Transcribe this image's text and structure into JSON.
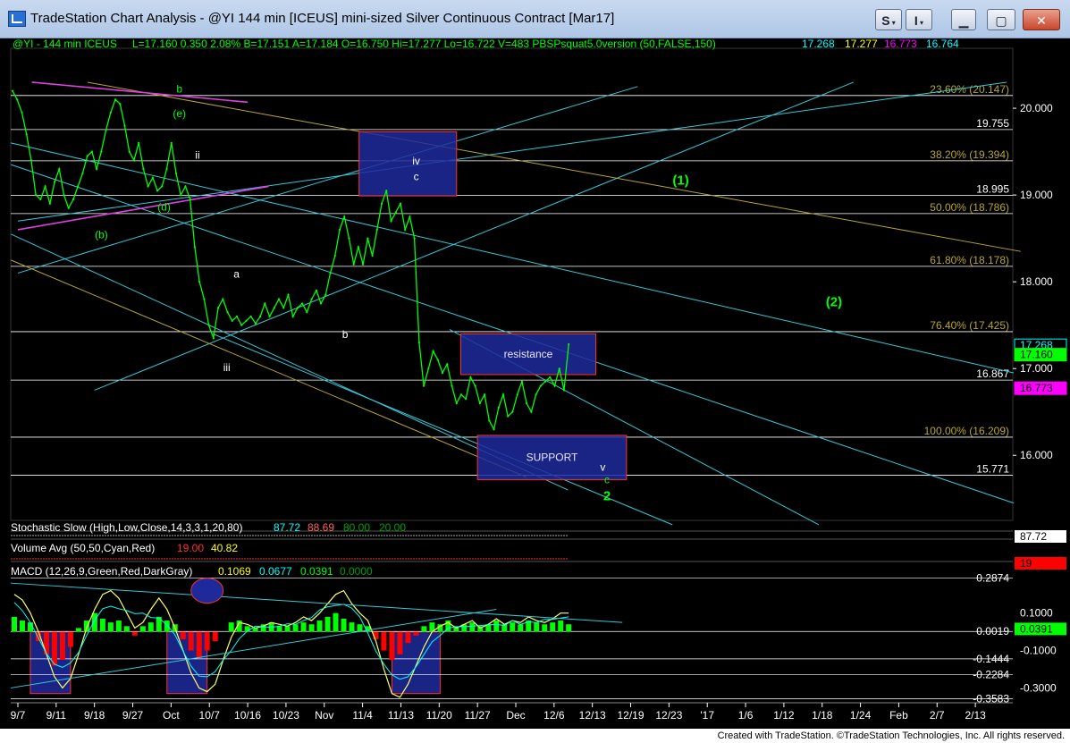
{
  "window": {
    "title": "TradeStation Chart Analysis - @YI 144 min [ICEUS] mini-sized Silver Continuous Contract [Mar17]",
    "buttons": [
      "S",
      "I"
    ],
    "icons": [
      "app-icon",
      "dropdown-arrow-icon",
      "minimize-icon",
      "maximize-icon",
      "close-icon"
    ]
  },
  "colors": {
    "background": "#000000",
    "price": "#00ff00",
    "fib": "#ffffff",
    "trendline": "#35c8d8",
    "goldline": "#b8a530",
    "magenta": "#e040e0",
    "box": "#1e2a9c",
    "boxborder": "#ff3030",
    "green": "#00ff00",
    "red": "#ff0000",
    "yellow": "#ffff00",
    "cyan": "#00ffff",
    "magentaLabel": "#ff00ff"
  },
  "header": {
    "symbol": "@YI - 144 min  ICEUS",
    "stats": "L=17.160  0.350  2.08%  B=17.151  A=17.184  O=16.750  Hi=17.277  Lo=16.722  V=483  PBSPsquat5.0version (50,FALSE,150)",
    "v1": "17.268",
    "v2": "17.277",
    "v3": "16.773",
    "v4": "16.764"
  },
  "footer": "Created with TradeStation. ©TradeStation Technologies, Inc. All rights reserved.",
  "chart_data": [
    {
      "type": "line",
      "name": "price",
      "x_labels": [
        "9/7",
        "9/11",
        "9/18",
        "9/27",
        "Oct",
        "10/7",
        "10/16",
        "10/23",
        "Nov",
        "11/4",
        "11/13",
        "11/20",
        "11/27",
        "Dec",
        "12/6",
        "12/13",
        "12/19",
        "12/23",
        "'17",
        "1/6",
        "1/12",
        "1/18",
        "1/24",
        "Feb",
        "2/7",
        "2/13"
      ],
      "y_ticks": [
        16.0,
        17.0,
        18.0,
        19.0,
        20.0
      ],
      "y_tick_labels": [
        "16.000",
        "17.000",
        "18.000",
        "19.000",
        "20.000"
      ],
      "ylim": [
        15.25,
        20.65
      ],
      "series": [
        {
          "values": [
            20.2,
            20.1,
            19.95,
            19.7,
            19.4,
            19.0,
            18.95,
            19.1,
            18.9,
            19.15,
            19.3,
            19.0,
            18.85,
            18.95,
            19.1,
            19.25,
            19.45,
            19.5,
            19.3,
            19.5,
            19.75,
            19.95,
            20.1,
            20.05,
            19.8,
            19.5,
            19.4,
            19.6,
            19.3,
            19.1,
            19.2,
            19.05,
            19.1,
            19.3,
            19.6,
            19.25,
            19.0,
            19.1,
            18.95,
            18.4,
            18.0,
            17.8,
            17.5,
            17.35,
            17.7,
            17.8,
            17.65,
            17.55,
            17.6,
            17.5,
            17.55,
            17.6,
            17.52,
            17.6,
            17.75,
            17.6,
            17.7,
            17.8,
            17.7,
            17.85,
            17.6,
            17.7,
            17.75,
            17.65,
            17.8,
            17.9,
            17.75,
            17.85,
            18.1,
            18.3,
            18.6,
            18.75,
            18.5,
            18.2,
            18.4,
            18.2,
            18.5,
            18.3,
            18.6,
            18.9,
            19.05,
            18.7,
            18.8,
            18.9,
            18.6,
            18.75,
            18.5,
            17.3,
            16.8,
            17.0,
            17.2,
            17.1,
            16.95,
            17.05,
            16.8,
            16.6,
            16.7,
            16.65,
            16.9,
            16.8,
            16.6,
            16.7,
            16.4,
            16.3,
            16.55,
            16.7,
            16.45,
            16.5,
            16.7,
            16.85,
            16.6,
            16.5,
            16.7,
            16.8,
            16.85,
            16.9,
            16.8,
            17.0,
            16.75,
            17.28
          ]
        }
      ],
      "fib_levels": [
        {
          "label": "23.60% (20.147)",
          "value": 20.147
        },
        {
          "label": "19.755",
          "value": 19.755
        },
        {
          "label": "38.20% (19.394)",
          "value": 19.394
        },
        {
          "label": "18.995",
          "value": 18.995
        },
        {
          "label": "50.00% (18.786)",
          "value": 18.786
        },
        {
          "label": "61.80% (18.178)",
          "value": 18.178
        },
        {
          "label": "76.40% (17.425)",
          "value": 17.425
        },
        {
          "label": "16.867",
          "value": 16.867
        },
        {
          "label": "100.00% (16.209)",
          "value": 16.209
        },
        {
          "label": "15.771",
          "value": 15.771
        }
      ],
      "price_tags": [
        {
          "label": "17.268",
          "value": 17.268,
          "bg": "#000000",
          "fg": "#00ffff"
        },
        {
          "label": "17.160",
          "value": 17.16,
          "bg": "#00ff00",
          "fg": "#000000"
        },
        {
          "label": "16.773",
          "value": 16.773,
          "bg": "#ff00ff",
          "fg": "#000000"
        }
      ],
      "boxes": [
        {
          "label": "",
          "x0": 24.5,
          "x1": 31.5,
          "y0": 18.99,
          "y1": 19.73
        },
        {
          "label": "resistance",
          "x0": 31.8,
          "x1": 41.5,
          "y0": 16.93,
          "y1": 17.4
        },
        {
          "label": "SUPPORT",
          "x0": 33.0,
          "x1": 43.7,
          "y0": 15.72,
          "y1": 16.23
        }
      ],
      "wave_labels": [
        {
          "text": "b",
          "x": 11.6,
          "y": 20.18,
          "color": "#00ff00"
        },
        {
          "text": "(e)",
          "x": 11.6,
          "y": 19.9,
          "color": "#00ff00"
        },
        {
          "text": "ii",
          "x": 12.9,
          "y": 19.42,
          "color": "#ffffff"
        },
        {
          "text": "(d)",
          "x": 10.5,
          "y": 18.82,
          "color": "#00ff00"
        },
        {
          "text": "(b)",
          "x": 6.0,
          "y": 18.5,
          "color": "#00ff00"
        },
        {
          "text": "a",
          "x": 15.7,
          "y": 18.05,
          "color": "#ffffff"
        },
        {
          "text": "iii",
          "x": 15.0,
          "y": 16.97,
          "color": "#ffffff"
        },
        {
          "text": "b",
          "x": 23.5,
          "y": 17.35,
          "color": "#ffffff"
        },
        {
          "text": "iv",
          "x": 28.6,
          "y": 19.35,
          "color": "#ffffff"
        },
        {
          "text": "c",
          "x": 28.6,
          "y": 19.17,
          "color": "#ffffff"
        },
        {
          "text": "v",
          "x": 42.0,
          "y": 15.82,
          "color": "#ffffff"
        },
        {
          "text": "c",
          "x": 42.3,
          "y": 15.68,
          "color": "#00ff00"
        },
        {
          "text": "2",
          "x": 42.3,
          "y": 15.48,
          "color": "#00ff00"
        },
        {
          "text": "(1)",
          "x": 47.6,
          "y": 19.12,
          "color": "#00ff00"
        },
        {
          "text": "(2)",
          "x": 58.6,
          "y": 17.72,
          "color": "#00ff00"
        }
      ]
    },
    {
      "type": "line",
      "name": "Stochastic Slow",
      "title": "Stochastic Slow (High,Low,Close,14,3,3,1,20,80)",
      "values_shown": [
        "87.72",
        "88.69",
        "80.00",
        "20.00"
      ],
      "axis_tag": "87.72"
    },
    {
      "type": "bar",
      "name": "Volume Avg",
      "title": "Volume Avg (50,50,Cyan,Red)",
      "values_shown": [
        "19.00",
        "40.82"
      ],
      "axis_tag": "19"
    },
    {
      "type": "bar",
      "name": "MACD",
      "title": "MACD (12,26,9,Green,Red,DarkGray)",
      "values_shown": [
        "0.1069",
        "0.0677",
        "0.0391",
        "0.0000"
      ],
      "ylim": [
        -0.36,
        0.28
      ],
      "y_tick_labels": [
        "0.2874",
        "0.1000",
        "0.0019",
        "0.0391",
        "-0.1000",
        "-0.1444",
        "-0.2284",
        "-0.3000",
        "-0.3583"
      ],
      "histogram": [
        0.08,
        0.06,
        0.05,
        -0.05,
        -0.12,
        -0.18,
        -0.15,
        -0.08,
        0.02,
        0.06,
        0.1,
        0.07,
        0.05,
        0.06,
        0.03,
        -0.02,
        0.03,
        0.05,
        0.08,
        0.06,
        0.04,
        -0.04,
        -0.1,
        -0.14,
        -0.1,
        -0.05,
        0.0,
        0.05,
        0.06,
        0.03,
        0.02,
        0.04,
        0.05,
        0.03,
        0.03,
        0.04,
        0.05,
        0.04,
        0.06,
        0.08,
        0.1,
        0.07,
        0.05,
        0.04,
        0.03,
        -0.04,
        -0.1,
        -0.15,
        -0.12,
        -0.06,
        -0.02,
        0.03,
        0.05,
        0.04,
        0.06,
        0.03,
        0.04,
        0.05,
        0.03,
        0.04,
        0.06,
        0.04,
        0.05,
        0.04,
        0.06,
        0.05,
        0.04,
        0.05,
        0.06,
        0.04
      ],
      "macd_line": [
        0.2,
        0.17,
        0.1,
        0.0,
        -0.12,
        -0.24,
        -0.3,
        -0.25,
        -0.12,
        0.02,
        0.12,
        0.2,
        0.22,
        0.18,
        0.1,
        0.02,
        0.05,
        0.12,
        0.18,
        0.12,
        0.02,
        -0.1,
        -0.22,
        -0.3,
        -0.32,
        -0.28,
        -0.15,
        -0.03,
        0.05,
        0.04,
        0.02,
        0.03,
        0.05,
        0.04,
        0.03,
        0.05,
        0.08,
        0.06,
        0.1,
        0.15,
        0.2,
        0.22,
        0.15,
        0.1,
        0.06,
        -0.05,
        -0.2,
        -0.33,
        -0.35,
        -0.28,
        -0.18,
        -0.08,
        0.0,
        0.03,
        0.05,
        0.02,
        0.04,
        0.06,
        0.02,
        0.04,
        0.07,
        0.04,
        0.06,
        0.05,
        0.08,
        0.06,
        0.05,
        0.07,
        0.1,
        0.1
      ],
      "boxes": [
        {
          "x0": 2,
          "x1": 7
        },
        {
          "x0": 19,
          "x1": 24
        },
        {
          "x0": 47,
          "x1": 53
        }
      ]
    }
  ]
}
